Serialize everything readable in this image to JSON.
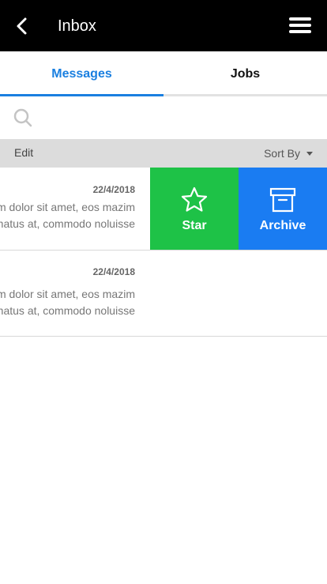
{
  "header": {
    "title": "Inbox"
  },
  "tabs": [
    {
      "label": "Messages",
      "active": true
    },
    {
      "label": "Jobs",
      "active": false
    }
  ],
  "search": {
    "placeholder": "",
    "value": ""
  },
  "toolbar": {
    "edit_label": "Edit",
    "sort_label": "Sort By"
  },
  "messages": [
    {
      "date": "22/4/2018",
      "line1": "Lorem ipsum dolor sit amet, eos mazim",
      "line2": "nominavi ornatus at, commodo noluisse",
      "actions": [
        {
          "label": "Star",
          "icon": "star-icon",
          "color": "#1ec247"
        },
        {
          "label": "Archive",
          "icon": "archive-icon",
          "color": "#1a7cf2"
        }
      ]
    },
    {
      "date": "22/4/2018",
      "line1": "Lorem ipsum dolor sit amet, eos mazim",
      "line2": "nominavi ornatus at, commodo noluisse"
    }
  ],
  "colors": {
    "accent": "#1a7fe0",
    "header_bg": "#000000",
    "toolbar_bg": "#dcdcdc"
  }
}
